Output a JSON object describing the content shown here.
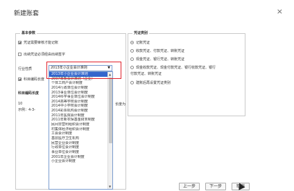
{
  "dialog": {
    "title": "新建账套",
    "close_glyph": "×"
  },
  "basic": {
    "legend": "基本参数",
    "opt1": "凭证需要审核才能记账",
    "opt2": "出纳凭证必须经由出纳签字",
    "industry_label": "行业性质",
    "industry_value": "2013年小企业会计准则",
    "allow_label": "科目编码长度",
    "code_label": "科目编码长度",
    "code_value": "10",
    "example": "示例：4-3-",
    "right_fragment": "长度为"
  },
  "voucher": {
    "legend": "凭证类别",
    "r1": "记账凭证",
    "r2": "收款凭证、付款凭证、转账凭证",
    "r3": "现金凭证、银行凭证、转账凭证",
    "r4a": "现金收款凭证、现金付款凭证、银行收款凭证、银行",
    "r4b": "付款凭证、转账凭证",
    "r5": "建账后再设置凭证类别"
  },
  "dropdown": {
    "items": [
      "2013年小企业会计准则",
      "2007年新会计准则（企业）",
      "个体工商户会计制度",
      "2014行政单位会计制度",
      "2013事业单位会计制度",
      "2014科学事业单位会计制度",
      "2014高等学校会计制度",
      "2014中小学校会计制度",
      "2014彩票机构会计制度",
      "2011年医院会计制度",
      "2011年新农保基金财务制度",
      "民间非营利组织会计制度",
      "村集体经济组织会计制度",
      "工会会计制度",
      "基层医疗卫生机构",
      "民营企业会计制度",
      "行政单位会计制度",
      "事业单位会计制度",
      "2001年企业会计制度",
      "小企业会计制度"
    ],
    "selected_index": 0
  },
  "buttons": {
    "prev": "上一步",
    "next": "下一步",
    "cancel": "取消"
  }
}
